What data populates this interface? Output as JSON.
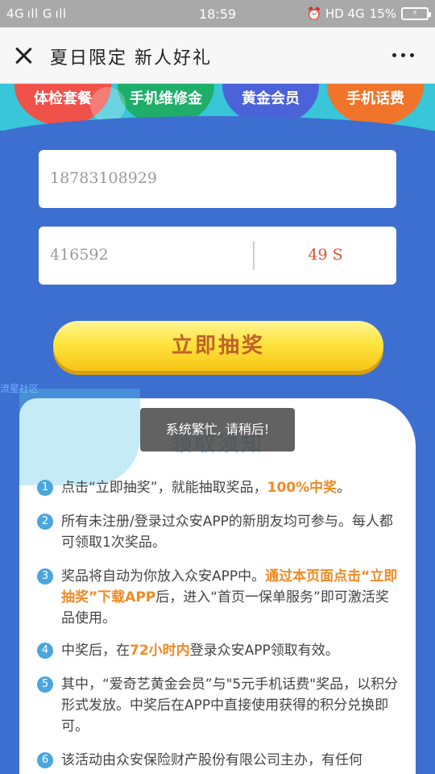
{
  "status_bar": {
    "signal": "4G ıll G ıll",
    "time": "18:59",
    "right_indicators": "⏰ HD 4G",
    "battery": "15%"
  },
  "header": {
    "title": "夏日限定 新人好礼"
  },
  "prizes": [
    {
      "label": "体检套餐",
      "color": "#f0524a"
    },
    {
      "label": "手机维修金",
      "color": "#1fae6a"
    },
    {
      "label": "黄金会员",
      "color": "#4b62d8"
    },
    {
      "label": "手机话费",
      "color": "#f0742a"
    }
  ],
  "form": {
    "phone_value": "18783108929",
    "code_value": "416592",
    "countdown": "49 S"
  },
  "lottery_button": "立即抽奖",
  "watermark": "流星社区",
  "rules": {
    "title": "领取须知",
    "items": [
      {
        "num": "1",
        "pre": "点击“立即抽奖”，就能抽取奖品，",
        "highlight": "100%中奖",
        "post": "。"
      },
      {
        "num": "2",
        "pre": "所有未注册/登录过众安APP的新朋友均可参与。每人都可领取1次奖品。",
        "highlight": "",
        "post": ""
      },
      {
        "num": "3",
        "pre": "奖品将自动为你放入众安APP中。",
        "highlight": "通过本页面点击“立即抽奖”下载APP",
        "post": "后，进入“首页一保单服务”即可激活奖品使用。"
      },
      {
        "num": "4",
        "pre": "中奖后，在",
        "highlight": "72小时内",
        "post": "登录众安APP领取有效。"
      },
      {
        "num": "5",
        "pre": "其中，“爱奇艺黄金会员”与\"5元手机话费\"奖品，以积分形式发放。中奖后在APP中直接使用获得的积分兑换即可。",
        "highlight": "",
        "post": ""
      },
      {
        "num": "6",
        "pre": "该活动由众安保险财产股份有限公司主办，有任何",
        "highlight": "",
        "post": ""
      }
    ]
  },
  "toast": "系统繁忙, 请稍后!"
}
